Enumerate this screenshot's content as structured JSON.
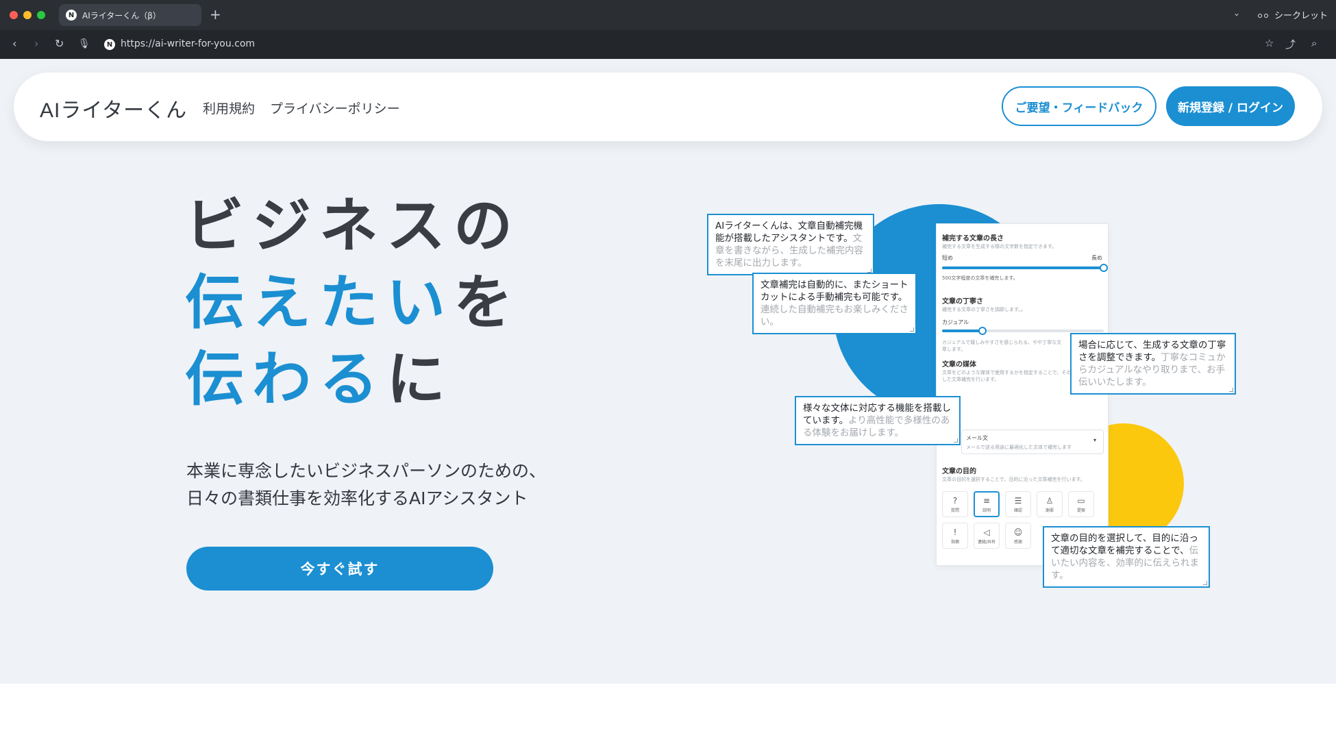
{
  "browser": {
    "tab_title": "AIライターくん（β）",
    "favicon_letter": "N",
    "url": "https://ai-writer-for-you.com",
    "incognito_label": "シークレット"
  },
  "header": {
    "logo": "AIライターくん",
    "nav": [
      "利用規約",
      "プライバシーポリシー"
    ],
    "feedback_button": "ご要望・フィードバック",
    "login_button": "新規登録 / ログイン"
  },
  "hero": {
    "line1": "ビジネスの",
    "line2_blue": "伝えたい",
    "line2_dark": "を",
    "line3_blue": "伝わる",
    "line3_dark": "に",
    "sub1": "本業に専念したいビジネスパーソンのための、",
    "sub2": "日々の書類仕事を効率化するAIアシスタント",
    "cta": "今すぐ試す"
  },
  "panel": {
    "length_title": "補完する文章の長さ",
    "length_desc": "補完する文章を生成する際の文字数を指定できます。",
    "length_min": "短め",
    "length_max": "長め",
    "length_note": "500文字程度の文章を補完します。",
    "length_level": 1.0,
    "politeness_title": "文章の丁寧さ",
    "politeness_desc": "補完する文章の丁寧さを調節します。。",
    "politeness_label": "カジュアル",
    "politeness_level": 0.25,
    "politeness_note1": "カジュアルで親しみやすさを感じられる、やや丁寧な文",
    "politeness_note2": "章します。",
    "medium_title": "文章の媒体",
    "medium_desc1": "文章をどのような媒体で使用するかを指定することで、その",
    "medium_desc2": "した文章補完を行います。",
    "medium_value": "メール文",
    "medium_value_desc": "メールで送る用途に最適化した文体で補完します",
    "purpose_title": "文章の目的",
    "purpose_desc": "文章の目的を選択することで、目的に沿った文章補完を行います。",
    "purposes": [
      {
        "label": "質問",
        "icon": "question-icon",
        "glyph": "?"
      },
      {
        "label": "説明",
        "icon": "document-icon",
        "glyph": "≡"
      },
      {
        "label": "確認",
        "icon": "confirm-icon",
        "glyph": "☰"
      },
      {
        "label": "謝罪",
        "icon": "bow-icon",
        "glyph": "♙"
      },
      {
        "label": "提案",
        "icon": "proposal-icon",
        "glyph": "▭"
      },
      {
        "label": "指摘",
        "icon": "alert-icon",
        "glyph": "!"
      },
      {
        "label": "連絡/共有",
        "icon": "megaphone-icon",
        "glyph": "◁"
      },
      {
        "label": "感謝",
        "icon": "smile-icon",
        "glyph": "☺"
      }
    ]
  },
  "callouts": [
    {
      "strong": "AIライターくんは、文章自動補完機能が搭載したアシスタントです。",
      "dim": "文章を書きながら、生成した補完内容を末尾に出力します。"
    },
    {
      "strong": "文章補完は自動的に、またショートカットによる手動補完も可能です。",
      "dim": "連続した自動補完もお楽しみください。"
    },
    {
      "strong": "場合に応じて、生成する文章の丁寧さを調整できます。",
      "dim": "丁寧なコミュからカジュアルなやり取りまで、お手伝いいたします。"
    },
    {
      "strong": "様々な文体に対応する機能を搭載しています。",
      "dim": "より高性能で多様性のある体験をお届けします。"
    },
    {
      "strong": "文章の目的を選択して、目的に沿って適切な文章を補完することで、",
      "dim": "伝いたい内容を、効率的に伝えられます。"
    }
  ],
  "colors": {
    "accent": "#1b8fd2",
    "yellow": "#fcc80d",
    "background": "#eff2f6"
  }
}
